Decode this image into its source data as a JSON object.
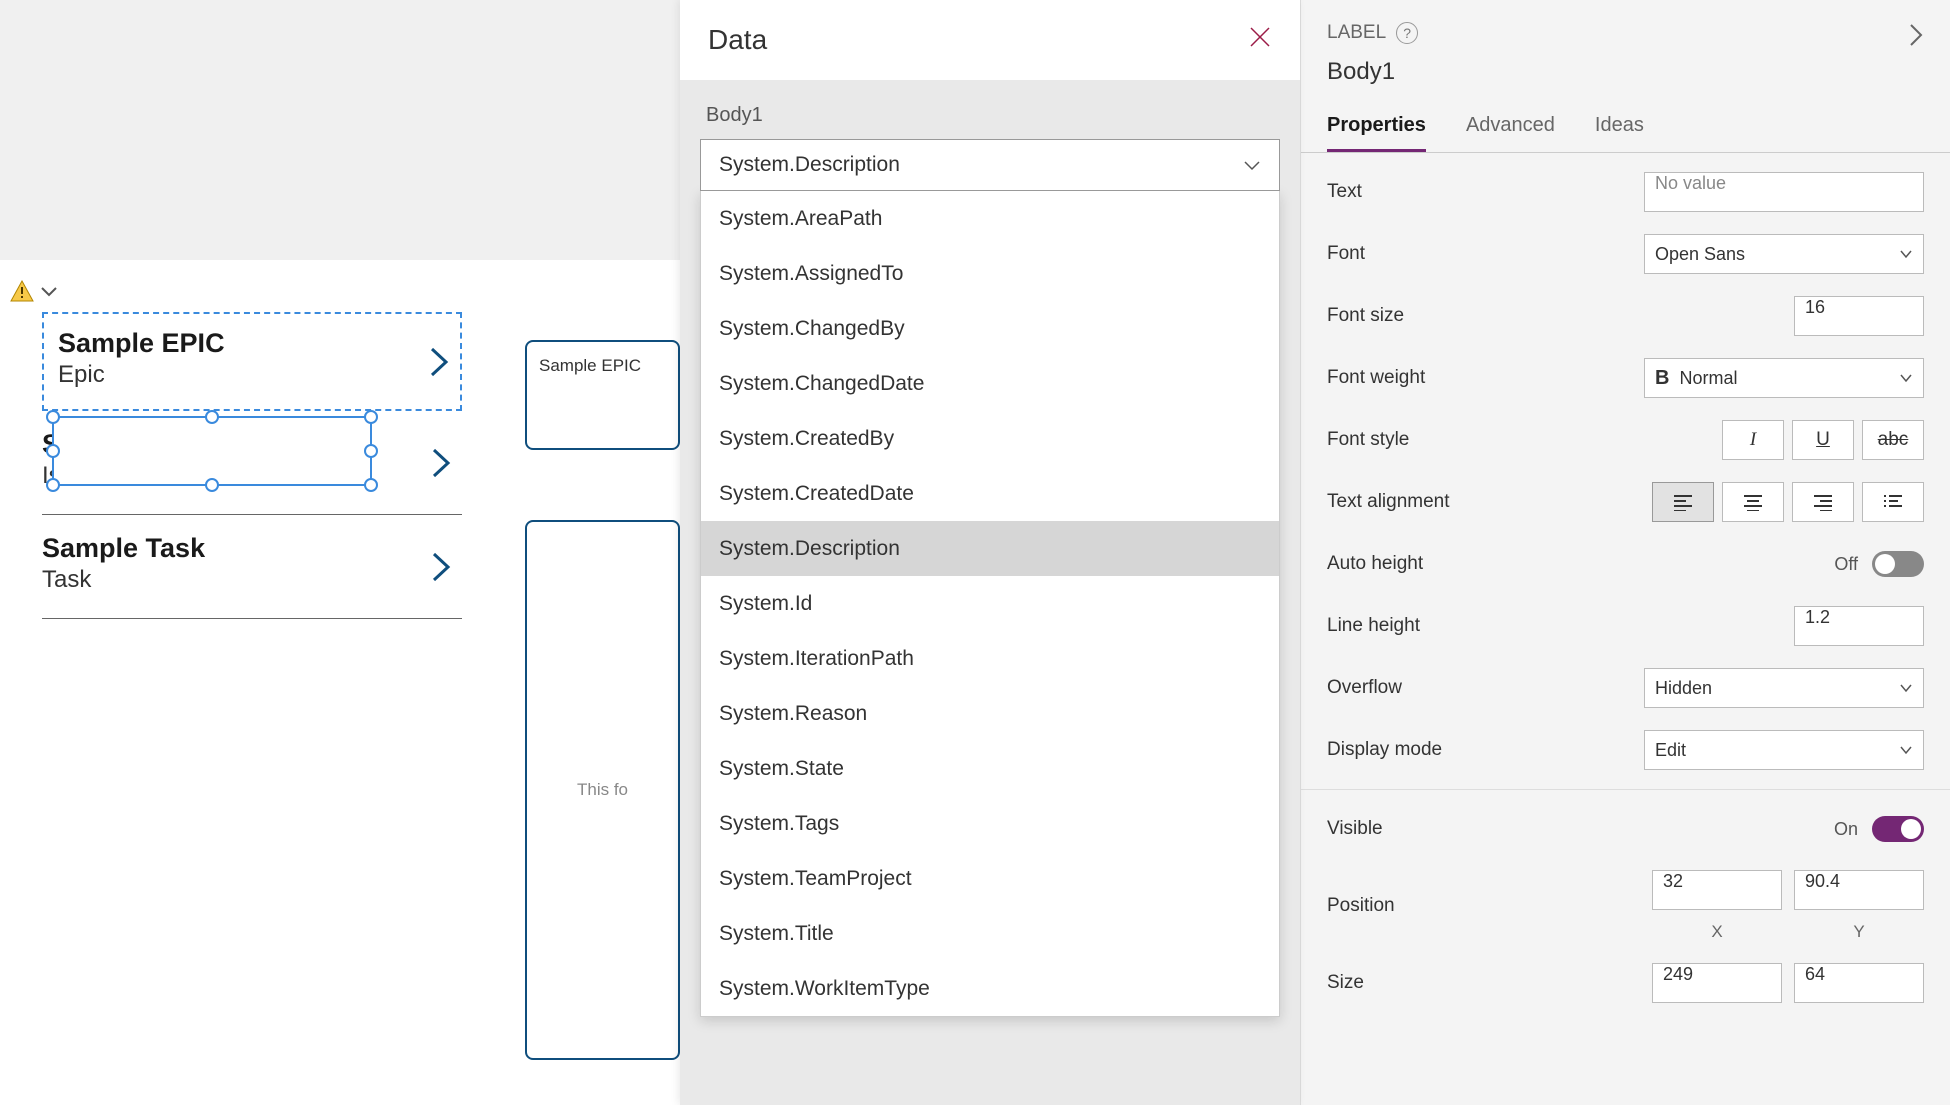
{
  "canvas": {
    "gallery": [
      {
        "title": "Sample EPIC",
        "subtitle": "Epic"
      },
      {
        "title": "Sample issue",
        "subtitle": "Issue"
      },
      {
        "title": "Sample Task",
        "subtitle": "Task"
      }
    ],
    "card_title": "Sample EPIC",
    "card_body_preview": "This fo"
  },
  "data_panel": {
    "title": "Data",
    "control_label": "Body1",
    "selected_field": "System.Description",
    "fields": [
      "System.AreaPath",
      "System.AssignedTo",
      "System.ChangedBy",
      "System.ChangedDate",
      "System.CreatedBy",
      "System.CreatedDate",
      "System.Description",
      "System.Id",
      "System.IterationPath",
      "System.Reason",
      "System.State",
      "System.Tags",
      "System.TeamProject",
      "System.Title",
      "System.WorkItemType"
    ]
  },
  "props": {
    "header_label": "LABEL",
    "control_name": "Body1",
    "tabs": {
      "properties": "Properties",
      "advanced": "Advanced",
      "ideas": "Ideas"
    },
    "rows": {
      "text": {
        "label": "Text",
        "placeholder": "No value"
      },
      "font": {
        "label": "Font",
        "value": "Open Sans"
      },
      "font_size": {
        "label": "Font size",
        "value": "16"
      },
      "font_weight": {
        "label": "Font weight",
        "value": "Normal",
        "bold_glyph": "B"
      },
      "font_style": {
        "label": "Font style"
      },
      "text_align": {
        "label": "Text alignment"
      },
      "auto_height": {
        "label": "Auto height",
        "state": "Off"
      },
      "line_height": {
        "label": "Line height",
        "value": "1.2"
      },
      "overflow": {
        "label": "Overflow",
        "value": "Hidden"
      },
      "display_mode": {
        "label": "Display mode",
        "value": "Edit"
      },
      "visible": {
        "label": "Visible",
        "state": "On"
      },
      "position": {
        "label": "Position",
        "x": "32",
        "y": "90.4",
        "xl": "X",
        "yl": "Y"
      },
      "size": {
        "label": "Size",
        "w": "249",
        "h": "64"
      }
    }
  }
}
